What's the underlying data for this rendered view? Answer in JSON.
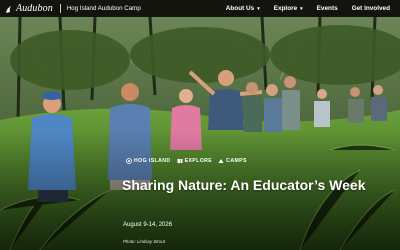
{
  "header": {
    "logo_text": "Audubon",
    "site_link": "Hog Island Audubon Camp",
    "nav": [
      {
        "label": "About Us",
        "has_dropdown": true
      },
      {
        "label": "Explore",
        "has_dropdown": true
      },
      {
        "label": "Events",
        "has_dropdown": false
      },
      {
        "label": "Get Involved",
        "has_dropdown": false
      }
    ]
  },
  "hero": {
    "tags": [
      {
        "label": "HOG ISLAND",
        "icon": "pin-icon"
      },
      {
        "label": "EXPLORE",
        "icon": "explore-icon"
      },
      {
        "label": "CAMPS",
        "icon": "camps-icon"
      }
    ],
    "title": "Sharing Nature: An Educator’s Week",
    "date": "August 9-14, 2026",
    "photo_credit": "Photo: Lindsay Strout"
  },
  "colors": {
    "header_bg": "#14140f",
    "text": "#ffffff",
    "fern_green": "#5d8f32",
    "forest_dark": "#2a3d1c"
  }
}
